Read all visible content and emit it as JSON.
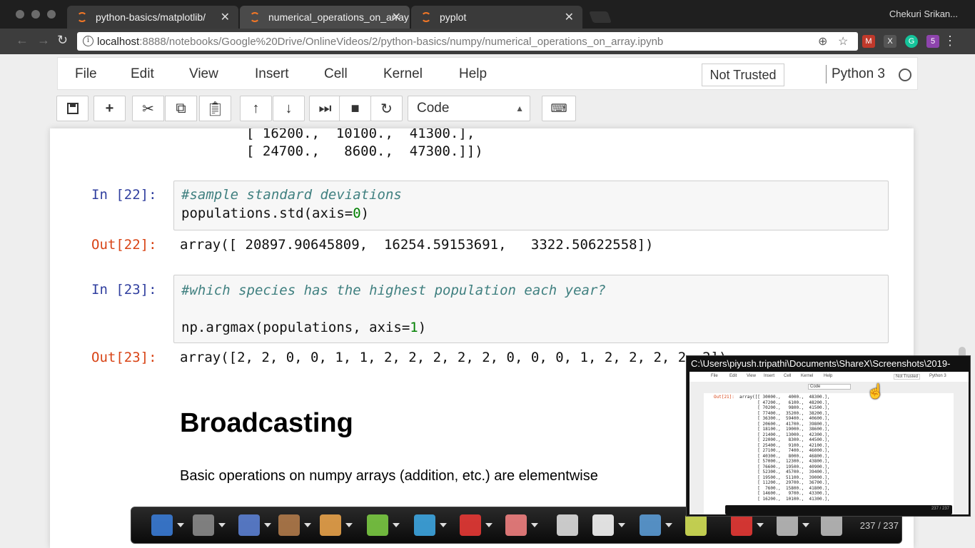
{
  "browser": {
    "tabs": [
      {
        "title": "python-basics/matplotlib/",
        "active": false
      },
      {
        "title": "numerical_operations_on_array",
        "active": true
      },
      {
        "title": "pyplot",
        "active": false
      }
    ],
    "profile_name": "Chekuri Srikan...",
    "url_host": "localhost",
    "url_rest": ":8888/notebooks/Google%20Drive/OnlineVideos/2/python-basics/numpy/numerical_operations_on_array.ipynb",
    "icons": {
      "back": "arrow-left-icon",
      "forward": "arrow-right-icon",
      "reload": "reload-icon",
      "zoom": "zoom-icon",
      "bookmark": "star-icon",
      "menu": "more-vert-icon"
    },
    "extensions": [
      {
        "name": "gmail-extension-icon",
        "color": "#c0392b",
        "glyph": "M"
      },
      {
        "name": "x-extension-icon",
        "color": "#555555",
        "glyph": "X"
      },
      {
        "name": "grammarly-extension-icon",
        "color": "#15c39a",
        "glyph": "G"
      },
      {
        "name": "profile-extension-icon",
        "color": "#8e44ad",
        "glyph": "5"
      }
    ]
  },
  "jupyter": {
    "menu": [
      "File",
      "Edit",
      "View",
      "Insert",
      "Cell",
      "Kernel",
      "Help"
    ],
    "trusted_label": "Not Trusted",
    "kernel_name": "Python 3",
    "cell_type": "Code",
    "toolbar_icons": [
      "save-icon",
      "add-cell-icon",
      "cut-icon",
      "copy-icon",
      "paste-icon",
      "move-up-icon",
      "move-down-icon",
      "run-icon",
      "stop-icon",
      "restart-icon",
      "keyboard-icon"
    ]
  },
  "notebook": {
    "prev_output_lines": [
      "[ 16200.,  10100.,  41300.],",
      "[ 24700.,   8600.,  47300.]])"
    ],
    "cell22": {
      "in_prompt": "In [22]:",
      "comment": "#sample standard deviations",
      "code_pre": "populations.std(axis=",
      "code_num": "0",
      "code_post": ")",
      "out_prompt": "Out[22]:",
      "output": "array([ 20897.90645809,  16254.59153691,   3322.50622558])"
    },
    "cell23": {
      "in_prompt": "In [23]:",
      "comment": "#which species has the highest population each year?",
      "code_pre": "np.argmax(populations, axis=",
      "code_num": "1",
      "code_post": ")",
      "out_prompt": "Out[23]:",
      "output": "array([2, 2, 0, 0, 1, 1, 2, 2, 2, 2, 2, 0, 0, 0, 1, 2, 2, 2, 2, 2])"
    },
    "heading": "Broadcasting",
    "paragraph": "Basic operations on numpy arrays (addition, etc.) are elementwise"
  },
  "annotation_toolbar": {
    "page_counter": "237 / 237",
    "tools": [
      {
        "name": "note-tool-icon",
        "color": "#3a7bd5"
      },
      {
        "name": "save-tool-icon",
        "color": "#8a8a8a"
      },
      {
        "name": "undo-tool-icon",
        "color": "#5b7fd1"
      },
      {
        "name": "redo-tool-icon",
        "color": "#b07a4a"
      },
      {
        "name": "pen-tool-icon",
        "color": "#e8a24a"
      },
      {
        "name": "highlighter-tool-icon",
        "color": "#7ac943"
      },
      {
        "name": "text-tool-icon",
        "color": "#3da5e0"
      },
      {
        "name": "shapes-tool-icon",
        "color": "#e53935"
      },
      {
        "name": "eraser-tool-icon",
        "color": "#f08080"
      },
      {
        "name": "pointer-tool-icon",
        "color": "#dddddd"
      },
      {
        "name": "whiteboard-tool-icon",
        "color": "#f5f5f5"
      },
      {
        "name": "line-tool-icon",
        "color": "#5b9bd5"
      },
      {
        "name": "fill-tool-icon",
        "color": "#d4e157"
      },
      {
        "name": "record-tool-icon",
        "color": "#e53935"
      },
      {
        "name": "webcam-tool-icon",
        "color": "#bdbdbd"
      },
      {
        "name": "settings-tool-icon",
        "color": "#bdbdbd"
      }
    ]
  },
  "preview_popup": {
    "title": "C:\\Users\\piyush.tripathi\\Documents\\ShareX\\Screenshots\\2019-",
    "out_prompt": "Out[21]:",
    "rows": [
      "array([[ 30000.,   4000.,  48300.],",
      "       [ 47200.,   6100.,  48200.],",
      "       [ 70200.,   9800.,  41500.],",
      "       [ 77400.,  35200.,  38200.],",
      "       [ 36300.,  59400.,  40600.],",
      "       [ 20600.,  41700.,  39800.],",
      "       [ 18100.,  19000.,  38600.],",
      "       [ 21400.,  13000.,  42300.],",
      "       [ 22000.,   8300.,  44500.],",
      "       [ 25400.,   9100.,  42100.],",
      "       [ 27100.,   7400.,  46000.],",
      "       [ 40300.,   8000.,  46800.],",
      "       [ 57000.,  12300.,  43800.],",
      "       [ 76600.,  19500.,  40900.],",
      "       [ 52300.,  45700.,  39400.],",
      "       [ 19500.,  51100.,  39000.],",
      "       [ 11200.,  29700.,  36700.],",
      "       [  7600.,  15800.,  41800.],",
      "       [ 14600.,   9700.,  43300.],",
      "       [ 16200.,  10100.,  41300.],"
    ],
    "menu": [
      "File",
      "Edit",
      "View",
      "Insert",
      "Cell",
      "Kernel",
      "Help"
    ],
    "trusted": "Not Trusted",
    "kernel": "Python 3",
    "cell_type": "Code"
  }
}
